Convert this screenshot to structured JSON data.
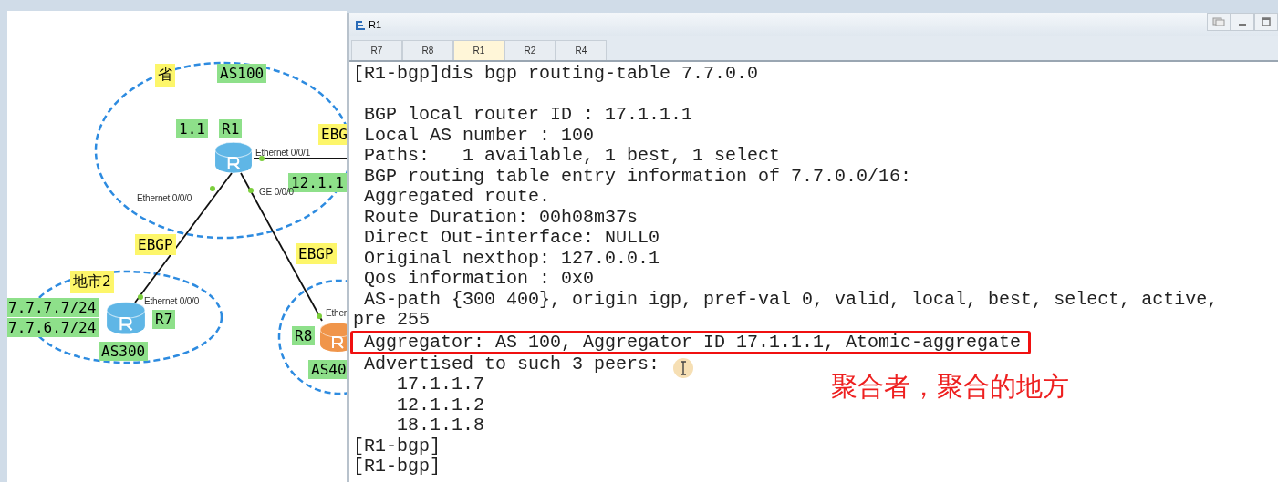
{
  "diagram": {
    "routers": [
      {
        "color": "#5fb6e6"
      },
      {
        "color": "#5fb6e6"
      },
      {
        "color": "#f0954a"
      }
    ],
    "labels": [
      {
        "text": "省",
        "kind": "area"
      },
      {
        "text": "AS100",
        "kind": "name"
      },
      {
        "text": "1.1",
        "kind": "name"
      },
      {
        "text": "R1",
        "kind": "name"
      },
      {
        "text": "EBG",
        "kind": "area"
      },
      {
        "text": "Ethernet 0/0/1",
        "kind": "port"
      },
      {
        "text": "12.1.1",
        "kind": "name"
      },
      {
        "text": "Ethernet 0/0/0",
        "kind": "port"
      },
      {
        "text": "GE 0/0/0",
        "kind": "port"
      },
      {
        "text": "EBGP",
        "kind": "area"
      },
      {
        "text": "EBGP",
        "kind": "area"
      },
      {
        "text": "地市2",
        "kind": "area"
      },
      {
        "text": "Ethernet 0/0/0",
        "kind": "port"
      },
      {
        "text": "7.7.7.7/24",
        "kind": "name"
      },
      {
        "text": "7.7.6.7/24",
        "kind": "name"
      },
      {
        "text": "R7",
        "kind": "name"
      },
      {
        "text": "AS300",
        "kind": "name"
      },
      {
        "text": "Ether",
        "kind": "port"
      },
      {
        "text": "R8",
        "kind": "name"
      },
      {
        "text": "AS40",
        "kind": "name"
      }
    ]
  },
  "window": {
    "title": "R1",
    "tabs": [
      {
        "label": "R7",
        "selected": false
      },
      {
        "label": "R8",
        "selected": false
      },
      {
        "label": "R1",
        "selected": true
      },
      {
        "label": "R2",
        "selected": false
      },
      {
        "label": "R4",
        "selected": false
      }
    ],
    "lines": [
      {
        "text": "[R1-bgp]dis bgp routing-table 7.7.0.0",
        "highlighted": false
      },
      {
        "text": " BGP local router ID : 17.1.1.1",
        "highlighted": false
      },
      {
        "text": " Local AS number : 100",
        "highlighted": false
      },
      {
        "text": " Paths:   1 available, 1 best, 1 select",
        "highlighted": false
      },
      {
        "text": " BGP routing table entry information of 7.7.0.0/16:",
        "highlighted": false
      },
      {
        "text": " Aggregated route.",
        "highlighted": false
      },
      {
        "text": " Route Duration: 00h08m37s",
        "highlighted": false
      },
      {
        "text": " Direct Out-interface: NULL0",
        "highlighted": false
      },
      {
        "text": " Original nexthop: 127.0.0.1",
        "highlighted": false
      },
      {
        "text": " Qos information : 0x0",
        "highlighted": false
      },
      {
        "text": " AS-path {300 400}, origin igp, pref-val 0, valid, local, best, select, active,",
        "highlighted": false
      },
      {
        "text": "pre 255",
        "highlighted": false
      },
      {
        "text": " Aggregator: AS 100, Aggregator ID 17.1.1.1, Atomic-aggregate",
        "highlighted": true
      },
      {
        "text": " Advertised to such 3 peers:",
        "highlighted": false
      },
      {
        "text": "    17.1.1.7",
        "highlighted": false
      },
      {
        "text": "    12.1.1.2",
        "highlighted": false
      },
      {
        "text": "    18.1.1.8",
        "highlighted": false
      },
      {
        "text": "[R1-bgp]",
        "highlighted": false
      },
      {
        "text": "[R1-bgp]",
        "highlighted": false
      }
    ],
    "annotation": "聚合者，聚合的地方"
  }
}
